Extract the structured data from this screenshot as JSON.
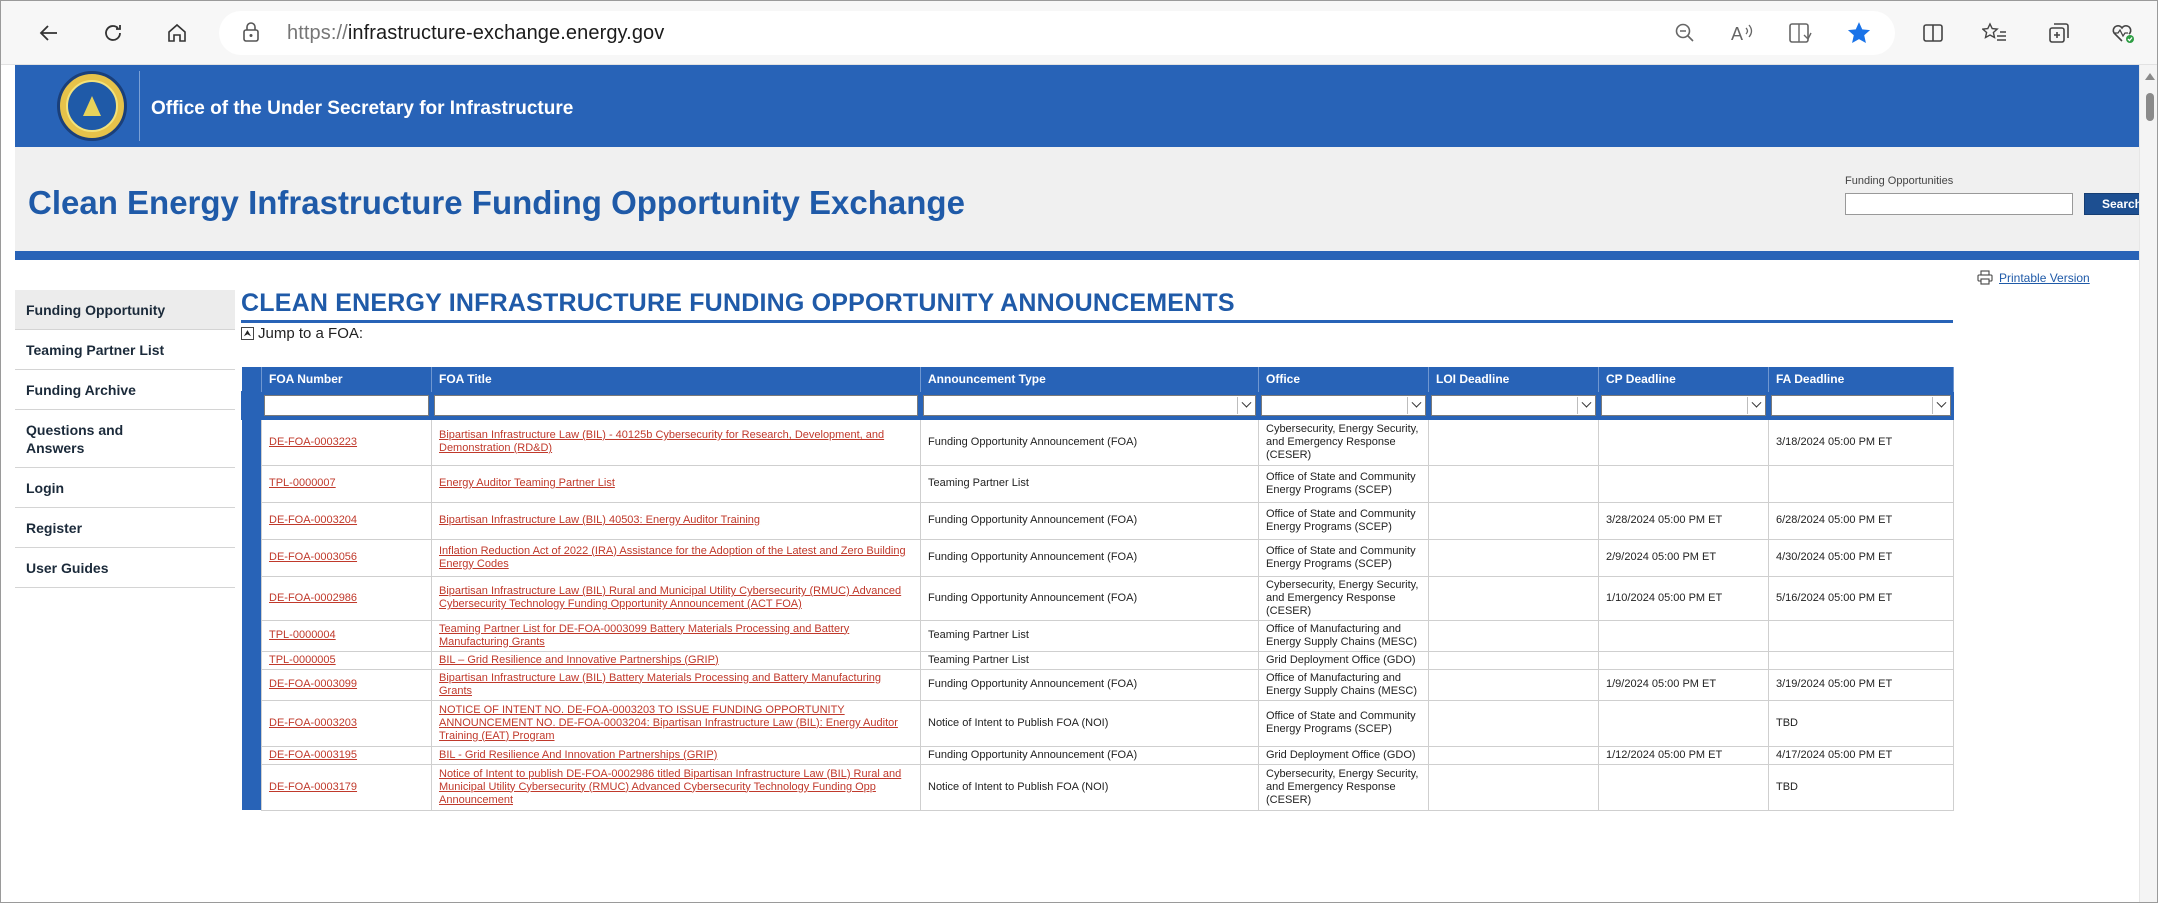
{
  "browser": {
    "url_proto": "https://",
    "url_host": "infrastructure-exchange.energy.gov"
  },
  "banner": {
    "title": "Office of the Under Secretary for Infrastructure"
  },
  "header": {
    "site_title": "Clean Energy Infrastructure Funding Opportunity Exchange",
    "search_label": "Funding Opportunities",
    "search_placeholder": "",
    "search_button": "Search"
  },
  "printable": "Printable Version",
  "sidebar": {
    "items": [
      {
        "label": "Funding Opportunity"
      },
      {
        "label": "Teaming Partner List"
      },
      {
        "label": "Funding Archive"
      },
      {
        "label": "Questions and Answers"
      },
      {
        "label": "Login"
      },
      {
        "label": "Register"
      },
      {
        "label": "User Guides"
      }
    ]
  },
  "main": {
    "title": "CLEAN ENERGY INFRASTRUCTURE FUNDING OPPORTUNITY ANNOUNCEMENTS",
    "jump": "Jump to a FOA:",
    "jump_icon": "⮝"
  },
  "table": {
    "headers": [
      "FOA Number",
      "FOA Title",
      "Announcement Type",
      "Office",
      "LOI Deadline",
      "CP Deadline",
      "FA Deadline"
    ],
    "rows": [
      {
        "num": "DE-FOA-0003223",
        "title": "Bipartisan Infrastructure Law (BIL) - 40125b Cybersecurity for Research, Development, and Demonstration (RD&D)",
        "type": "Funding Opportunity Announcement (FOA)",
        "office": "Cybersecurity, Energy Security, and Emergency Response (CESER)",
        "loi": "",
        "cp": "",
        "fa": "3/18/2024 05:00 PM ET"
      },
      {
        "num": "TPL-0000007",
        "title": "Energy Auditor Teaming Partner List",
        "type": "Teaming Partner List",
        "office": "Office of State and Community Energy Programs (SCEP)",
        "loi": "",
        "cp": "",
        "fa": ""
      },
      {
        "num": "DE-FOA-0003204",
        "title": "Bipartisan Infrastructure Law (BIL) 40503: Energy Auditor Training",
        "type": "Funding Opportunity Announcement (FOA)",
        "office": "Office of State and Community Energy Programs (SCEP)",
        "loi": "",
        "cp": "3/28/2024 05:00 PM ET",
        "fa": "6/28/2024 05:00 PM ET"
      },
      {
        "num": "DE-FOA-0003056",
        "title": "Inflation Reduction Act of 2022 (IRA) Assistance for the Adoption of the Latest and Zero Building Energy Codes",
        "type": "Funding Opportunity Announcement (FOA)",
        "office": "Office of State and Community Energy Programs (SCEP)",
        "loi": "",
        "cp": "2/9/2024 05:00 PM ET",
        "fa": "4/30/2024 05:00 PM ET"
      },
      {
        "num": "DE-FOA-0002986",
        "title": "Bipartisan Infrastructure Law (BIL) Rural and Municipal Utility Cybersecurity (RMUC) Advanced Cybersecurity Technology Funding Opportunity Announcement (ACT FOA)",
        "type": "Funding Opportunity Announcement (FOA)",
        "office": "Cybersecurity, Energy Security, and Emergency Response (CESER)",
        "loi": "",
        "cp": "1/10/2024 05:00 PM ET",
        "fa": "5/16/2024 05:00 PM ET"
      },
      {
        "num": "TPL-0000004",
        "title": "Teaming Partner List for DE-FOA-0003099 Battery Materials Processing and Battery Manufacturing Grants",
        "type": "Teaming Partner List",
        "office": "Office of Manufacturing and Energy Supply Chains (MESC)",
        "loi": "",
        "cp": "",
        "fa": ""
      },
      {
        "num": "TPL-0000005",
        "title": "BIL – Grid Resilience and Innovative Partnerships (GRIP)",
        "type": "Teaming Partner List",
        "office": "Grid Deployment Office (GDO)",
        "loi": "",
        "cp": "",
        "fa": ""
      },
      {
        "num": "DE-FOA-0003099",
        "title": "Bipartisan Infrastructure Law (BIL) Battery Materials Processing and Battery Manufacturing Grants",
        "type": "Funding Opportunity Announcement (FOA)",
        "office": "Office of Manufacturing and Energy Supply Chains (MESC)",
        "loi": "",
        "cp": "1/9/2024 05:00 PM ET",
        "fa": "3/19/2024 05:00 PM ET"
      },
      {
        "num": "DE-FOA-0003203",
        "title": "NOTICE OF INTENT NO. DE-FOA-0003203 TO ISSUE FUNDING OPPORTUNITY ANNOUNCEMENT NO. DE-FOA-0003204: Bipartisan Infrastructure Law (BIL): Energy Auditor Training (EAT) Program",
        "type": "Notice of Intent to Publish FOA (NOI)",
        "office": "Office of State and Community Energy Programs (SCEP)",
        "loi": "",
        "cp": "",
        "fa": "TBD"
      },
      {
        "num": "DE-FOA-0003195",
        "title": "BIL - Grid Resilience And Innovation Partnerships (GRIP)",
        "type": "Funding Opportunity Announcement (FOA)",
        "office": "Grid Deployment Office (GDO)",
        "loi": "",
        "cp": "1/12/2024 05:00 PM ET",
        "fa": "4/17/2024 05:00 PM ET"
      },
      {
        "num": "DE-FOA-0003179",
        "title": "Notice of Intent to publish DE-FOA-0002986 titled Bipartisan Infrastructure Law (BIL) Rural and Municipal Utility Cybersecurity (RMUC) Advanced Cybersecurity Technology Funding Opp Announcement",
        "type": "Notice of Intent to Publish FOA (NOI)",
        "office": "Cybersecurity, Energy Security, and Emergency Response (CESER)",
        "loi": "",
        "cp": "",
        "fa": "TBD"
      }
    ]
  },
  "colors": {
    "brand_blue": "#2863b7",
    "link_red": "#c0392b",
    "header_bg": "#f0f0f0"
  }
}
